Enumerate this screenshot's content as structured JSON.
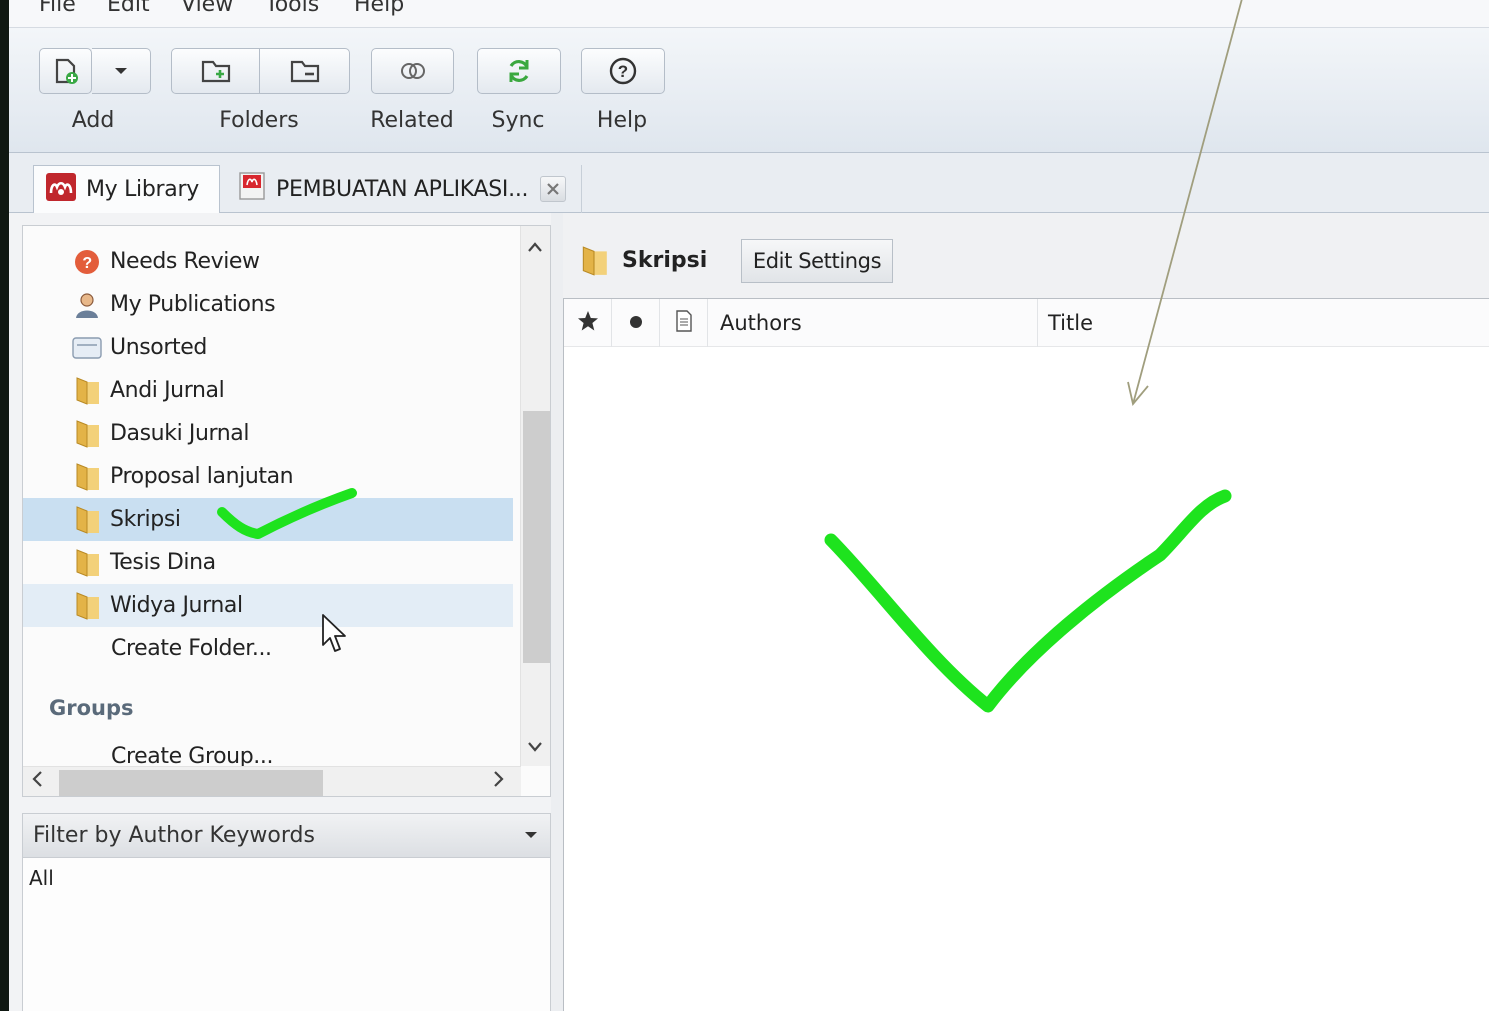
{
  "menu": {
    "items": [
      "File",
      "Edit",
      "View",
      "Tools",
      "Help"
    ]
  },
  "toolbar": {
    "add_label": "Add",
    "folders_label": "Folders",
    "related_label": "Related",
    "sync_label": "Sync",
    "help_label": "Help"
  },
  "tabs": {
    "library_label": "My Library",
    "document_label": "PEMBUATAN APLIKASI..."
  },
  "collections": {
    "items": [
      {
        "label": "Needs Review",
        "icon": "needs-review-icon"
      },
      {
        "label": "My Publications",
        "icon": "person-icon"
      },
      {
        "label": "Unsorted",
        "icon": "tray-icon"
      },
      {
        "label": "Andi Jurnal",
        "icon": "folder-icon"
      },
      {
        "label": "Dasuki Jurnal",
        "icon": "folder-icon"
      },
      {
        "label": "Proposal lanjutan",
        "icon": "folder-icon"
      },
      {
        "label": "Skripsi",
        "icon": "folder-icon"
      },
      {
        "label": "Tesis Dina",
        "icon": "folder-icon"
      },
      {
        "label": "Widya Jurnal",
        "icon": "folder-icon"
      }
    ],
    "create_folder": "Create Folder...",
    "groups_heading": "Groups",
    "create_group": "Create Group..."
  },
  "filter": {
    "label": "Filter by Author Keywords",
    "selected": "All"
  },
  "folder_view": {
    "name": "Skripsi",
    "edit_settings": "Edit Settings",
    "columns": {
      "authors": "Authors",
      "title": "Title"
    }
  },
  "colors": {
    "selected_row": "#c9dff1",
    "hover_row": "#e3edf6",
    "annotation_green": "#1ee31e",
    "arrow_line": "#a09e7e",
    "folder_yellow": "#e3b347",
    "mendeley_red": "#c0272d"
  }
}
